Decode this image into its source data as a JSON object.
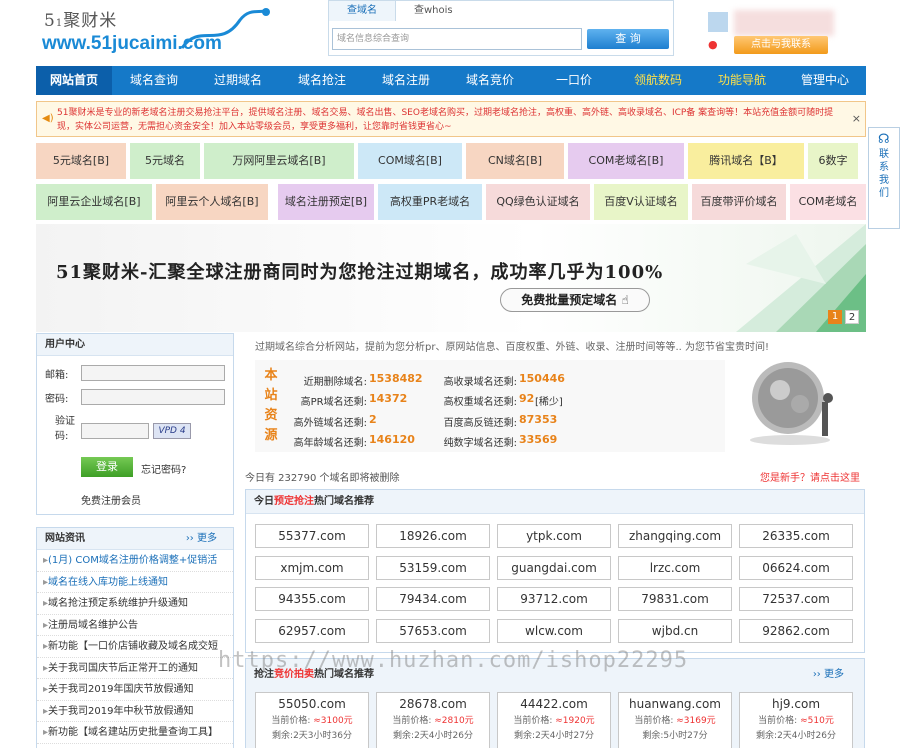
{
  "header": {
    "logo_top": "5",
    "logo_top_small": "1",
    "logo_top_name": "聚财米",
    "logo_url": "www.51jucaimi.com",
    "search_tabs": [
      "查域名",
      "查whois"
    ],
    "search_placeholder": "域名信息综合查询",
    "search_button": "查 询",
    "qq_button": "点击与我联系"
  },
  "nav": [
    "网站首页",
    "域名查询",
    "过期域名",
    "域名抢注",
    "域名注册",
    "域名竞价",
    "一口价",
    "领航数码",
    "功能导航",
    "管理中心"
  ],
  "notice": {
    "text": "51聚财米是专业的新老域名注册交易抢注平台，提供域名注册、域名交易、域名出售、SEO老域名购买，过期老域名抢注，高权重、高外链、高收录域名、ICP备 案查询等！本站充值金额可随时提现，实体公司运营，无需担心资金安全！加入本站零级会员，享受更多福利，让您靠时省钱更省心~",
    "close": "×"
  },
  "tags": [
    {
      "label": "5元域名[B]",
      "color": "#f7d6c2"
    },
    {
      "label": "5元域名",
      "color": "#cfeecb"
    },
    {
      "label": "万网阿里云域名[B]",
      "color": "#cfeecb"
    },
    {
      "label": "COM域名[B]",
      "color": "#cde8f7"
    },
    {
      "label": "CN域名[B]",
      "color": "#f7d6c2"
    },
    {
      "label": "COM老域名[B]",
      "color": "#e6cbef"
    },
    {
      "label": "腾讯域名【B】",
      "color": "#f9ee9e"
    },
    {
      "label": "6数字",
      "color": "#e8f5c8"
    },
    {
      "label": "阿里云企业域名[B]",
      "color": "#cfeecb"
    },
    {
      "label": "阿里云个人域名[B]",
      "color": "#f7d6c2"
    },
    {
      "label": "域名注册预定[B]",
      "color": "#e6cbef"
    },
    {
      "label": "高权重PR老域名",
      "color": "#cde8f7"
    },
    {
      "label": "QQ绿色认证域名",
      "color": "#f6dada"
    },
    {
      "label": "百度V认证域名",
      "color": "#e8f5c8"
    },
    {
      "label": "百度带评价域名",
      "color": "#f6dada"
    },
    {
      "label": "COM老域名",
      "color": "#fbe0e4"
    }
  ],
  "side_float": {
    "chars": [
      "联",
      "系",
      "我",
      "们"
    ]
  },
  "banner": {
    "headline": "51聚财米-汇聚全球注册商同时为您抢注过期域名，成功率几乎为100%",
    "button": "免费批量预定域名",
    "pages": [
      "1",
      "2"
    ]
  },
  "user_center": {
    "title": "用户中心",
    "email_label": "邮箱:",
    "password_label": "密码:",
    "captcha_label": "验证码:",
    "captcha_text": "VPD 4",
    "login_button": "登录",
    "forgot": "忘记密码?",
    "register": "免费注册会员"
  },
  "news": {
    "title": "网站资讯",
    "more": "更多",
    "items": [
      {
        "text": "(1月) COM域名注册价格调整+促销活",
        "color": "#1a6fb8"
      },
      {
        "text": "域名在线入库功能上线通知",
        "color": "#1a6fb8"
      },
      {
        "text": "域名抢注预定系统维护升级通知",
        "color": "#333"
      },
      {
        "text": "注册局域名维护公告",
        "color": "#333"
      },
      {
        "text": "新功能【一口价店铺收藏及域名成交短",
        "color": "#333"
      },
      {
        "text": "关于我司国庆节后正常开工的通知",
        "color": "#333"
      },
      {
        "text": "关于我司2019年国庆节放假通知",
        "color": "#333"
      },
      {
        "text": "关于我司2019年中秋节放假通知",
        "color": "#333"
      },
      {
        "text": "新功能【域名建站历史批量查询工具】",
        "color": "#333"
      }
    ]
  },
  "stats": {
    "desc": "过期域名综合分析网站，提前为您分析pr、原网站信息、百度权重、外链、收录、注册时间等等.. 为您节省宝贵时间!",
    "title_chars": [
      "本",
      "站",
      "资",
      "源"
    ],
    "rows": [
      {
        "l1": "近期删除域名:",
        "v1": "1538482",
        "l2": "高收录域名还剩:",
        "v2": "150446"
      },
      {
        "l1": "高PR域名还剩:",
        "v1": "14372",
        "l2": "高权重域名还剩:",
        "v2": "92",
        "v2b": "[稀少]"
      },
      {
        "l1": "高外链域名还剩:",
        "v1": "2",
        "l2": "百度高反链还剩:",
        "v2": "87353"
      },
      {
        "l1": "高年龄域名还剩:",
        "v1": "146120",
        "l2": "纯数字域名还剩:",
        "v2": "33569"
      }
    ],
    "today": "今日有 232790 个域名即将被删除",
    "newbie": "您是新手？请点击这里"
  },
  "hot_register": {
    "title_a": "今日",
    "title_b": "预定抢注",
    "title_c": "热门域名推荐",
    "domains": [
      "55377.com",
      "18926.com",
      "ytpk.com",
      "zhangqing.com",
      "26335.com",
      "xmjm.com",
      "53159.com",
      "guangdai.com",
      "lrzc.com",
      "06624.com",
      "94355.com",
      "79434.com",
      "93712.com",
      "79831.com",
      "72537.com",
      "62957.com",
      "57653.com",
      "wlcw.com",
      "wjbd.cn",
      "92862.com"
    ]
  },
  "hot_auction": {
    "title_a": "抢注",
    "title_b": "竞价拍卖",
    "title_c": "热门域名推荐",
    "more": "更多",
    "items": [
      {
        "name": "55050.com",
        "price_label": "当前价格:",
        "price": "≈3100元",
        "left": "剩余:2天3小时36分"
      },
      {
        "name": "28678.com",
        "price_label": "当前价格:",
        "price": "≈2810元",
        "left": "剩余:2天4小时26分"
      },
      {
        "name": "44422.com",
        "price_label": "当前价格:",
        "price": "≈1920元",
        "left": "剩余:2天4小时27分"
      },
      {
        "name": "huanwang.com",
        "price_label": "当前价格:",
        "price": "≈3169元",
        "left": "剩余:5小时27分"
      },
      {
        "name": "hj9.com",
        "price_label": "当前价格:",
        "price": "≈510元",
        "left": "剩余:2天4小时26分"
      }
    ]
  },
  "watermark": "https://www.huzhan.com/ishop22295"
}
